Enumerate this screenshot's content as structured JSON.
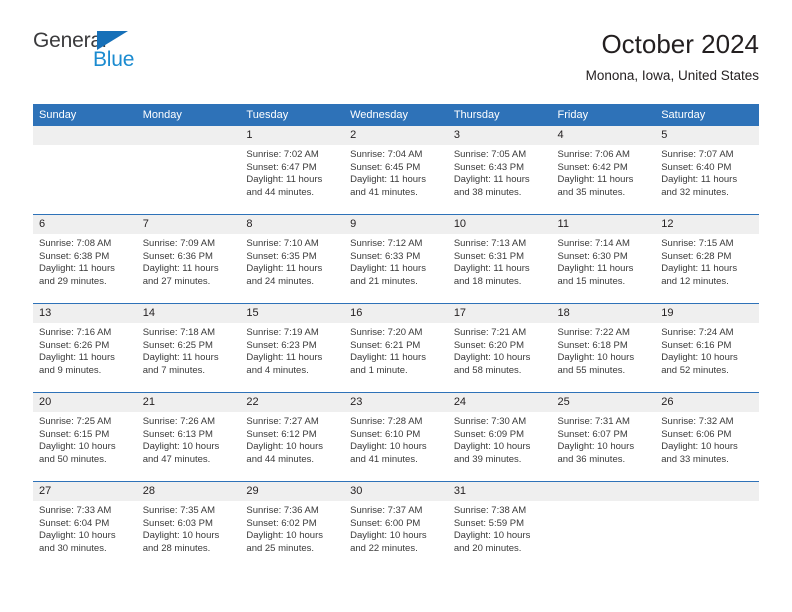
{
  "brand": {
    "name_part1": "General",
    "name_part2": "Blue",
    "triangle_icon": "triangle-icon",
    "accent_color": "#1b8bd0",
    "dark_color": "#3b3b3d"
  },
  "header": {
    "title": "October 2024",
    "subtitle": "Monona, Iowa, United States"
  },
  "theme": {
    "header_blue": "#2e72b8",
    "daynum_bg": "#efefef",
    "text": "#231f20"
  },
  "calendar": {
    "weekday_headers": [
      "Sunday",
      "Monday",
      "Tuesday",
      "Wednesday",
      "Thursday",
      "Friday",
      "Saturday"
    ],
    "weeks": [
      [
        {
          "day": "",
          "sunrise": "",
          "sunset": "",
          "daylight_line1": "",
          "daylight_line2": ""
        },
        {
          "day": "",
          "sunrise": "",
          "sunset": "",
          "daylight_line1": "",
          "daylight_line2": ""
        },
        {
          "day": "1",
          "sunrise": "Sunrise: 7:02 AM",
          "sunset": "Sunset: 6:47 PM",
          "daylight_line1": "Daylight: 11 hours",
          "daylight_line2": "and 44 minutes."
        },
        {
          "day": "2",
          "sunrise": "Sunrise: 7:04 AM",
          "sunset": "Sunset: 6:45 PM",
          "daylight_line1": "Daylight: 11 hours",
          "daylight_line2": "and 41 minutes."
        },
        {
          "day": "3",
          "sunrise": "Sunrise: 7:05 AM",
          "sunset": "Sunset: 6:43 PM",
          "daylight_line1": "Daylight: 11 hours",
          "daylight_line2": "and 38 minutes."
        },
        {
          "day": "4",
          "sunrise": "Sunrise: 7:06 AM",
          "sunset": "Sunset: 6:42 PM",
          "daylight_line1": "Daylight: 11 hours",
          "daylight_line2": "and 35 minutes."
        },
        {
          "day": "5",
          "sunrise": "Sunrise: 7:07 AM",
          "sunset": "Sunset: 6:40 PM",
          "daylight_line1": "Daylight: 11 hours",
          "daylight_line2": "and 32 minutes."
        }
      ],
      [
        {
          "day": "6",
          "sunrise": "Sunrise: 7:08 AM",
          "sunset": "Sunset: 6:38 PM",
          "daylight_line1": "Daylight: 11 hours",
          "daylight_line2": "and 29 minutes."
        },
        {
          "day": "7",
          "sunrise": "Sunrise: 7:09 AM",
          "sunset": "Sunset: 6:36 PM",
          "daylight_line1": "Daylight: 11 hours",
          "daylight_line2": "and 27 minutes."
        },
        {
          "day": "8",
          "sunrise": "Sunrise: 7:10 AM",
          "sunset": "Sunset: 6:35 PM",
          "daylight_line1": "Daylight: 11 hours",
          "daylight_line2": "and 24 minutes."
        },
        {
          "day": "9",
          "sunrise": "Sunrise: 7:12 AM",
          "sunset": "Sunset: 6:33 PM",
          "daylight_line1": "Daylight: 11 hours",
          "daylight_line2": "and 21 minutes."
        },
        {
          "day": "10",
          "sunrise": "Sunrise: 7:13 AM",
          "sunset": "Sunset: 6:31 PM",
          "daylight_line1": "Daylight: 11 hours",
          "daylight_line2": "and 18 minutes."
        },
        {
          "day": "11",
          "sunrise": "Sunrise: 7:14 AM",
          "sunset": "Sunset: 6:30 PM",
          "daylight_line1": "Daylight: 11 hours",
          "daylight_line2": "and 15 minutes."
        },
        {
          "day": "12",
          "sunrise": "Sunrise: 7:15 AM",
          "sunset": "Sunset: 6:28 PM",
          "daylight_line1": "Daylight: 11 hours",
          "daylight_line2": "and 12 minutes."
        }
      ],
      [
        {
          "day": "13",
          "sunrise": "Sunrise: 7:16 AM",
          "sunset": "Sunset: 6:26 PM",
          "daylight_line1": "Daylight: 11 hours",
          "daylight_line2": "and 9 minutes."
        },
        {
          "day": "14",
          "sunrise": "Sunrise: 7:18 AM",
          "sunset": "Sunset: 6:25 PM",
          "daylight_line1": "Daylight: 11 hours",
          "daylight_line2": "and 7 minutes."
        },
        {
          "day": "15",
          "sunrise": "Sunrise: 7:19 AM",
          "sunset": "Sunset: 6:23 PM",
          "daylight_line1": "Daylight: 11 hours",
          "daylight_line2": "and 4 minutes."
        },
        {
          "day": "16",
          "sunrise": "Sunrise: 7:20 AM",
          "sunset": "Sunset: 6:21 PM",
          "daylight_line1": "Daylight: 11 hours",
          "daylight_line2": "and 1 minute."
        },
        {
          "day": "17",
          "sunrise": "Sunrise: 7:21 AM",
          "sunset": "Sunset: 6:20 PM",
          "daylight_line1": "Daylight: 10 hours",
          "daylight_line2": "and 58 minutes."
        },
        {
          "day": "18",
          "sunrise": "Sunrise: 7:22 AM",
          "sunset": "Sunset: 6:18 PM",
          "daylight_line1": "Daylight: 10 hours",
          "daylight_line2": "and 55 minutes."
        },
        {
          "day": "19",
          "sunrise": "Sunrise: 7:24 AM",
          "sunset": "Sunset: 6:16 PM",
          "daylight_line1": "Daylight: 10 hours",
          "daylight_line2": "and 52 minutes."
        }
      ],
      [
        {
          "day": "20",
          "sunrise": "Sunrise: 7:25 AM",
          "sunset": "Sunset: 6:15 PM",
          "daylight_line1": "Daylight: 10 hours",
          "daylight_line2": "and 50 minutes."
        },
        {
          "day": "21",
          "sunrise": "Sunrise: 7:26 AM",
          "sunset": "Sunset: 6:13 PM",
          "daylight_line1": "Daylight: 10 hours",
          "daylight_line2": "and 47 minutes."
        },
        {
          "day": "22",
          "sunrise": "Sunrise: 7:27 AM",
          "sunset": "Sunset: 6:12 PM",
          "daylight_line1": "Daylight: 10 hours",
          "daylight_line2": "and 44 minutes."
        },
        {
          "day": "23",
          "sunrise": "Sunrise: 7:28 AM",
          "sunset": "Sunset: 6:10 PM",
          "daylight_line1": "Daylight: 10 hours",
          "daylight_line2": "and 41 minutes."
        },
        {
          "day": "24",
          "sunrise": "Sunrise: 7:30 AM",
          "sunset": "Sunset: 6:09 PM",
          "daylight_line1": "Daylight: 10 hours",
          "daylight_line2": "and 39 minutes."
        },
        {
          "day": "25",
          "sunrise": "Sunrise: 7:31 AM",
          "sunset": "Sunset: 6:07 PM",
          "daylight_line1": "Daylight: 10 hours",
          "daylight_line2": "and 36 minutes."
        },
        {
          "day": "26",
          "sunrise": "Sunrise: 7:32 AM",
          "sunset": "Sunset: 6:06 PM",
          "daylight_line1": "Daylight: 10 hours",
          "daylight_line2": "and 33 minutes."
        }
      ],
      [
        {
          "day": "27",
          "sunrise": "Sunrise: 7:33 AM",
          "sunset": "Sunset: 6:04 PM",
          "daylight_line1": "Daylight: 10 hours",
          "daylight_line2": "and 30 minutes."
        },
        {
          "day": "28",
          "sunrise": "Sunrise: 7:35 AM",
          "sunset": "Sunset: 6:03 PM",
          "daylight_line1": "Daylight: 10 hours",
          "daylight_line2": "and 28 minutes."
        },
        {
          "day": "29",
          "sunrise": "Sunrise: 7:36 AM",
          "sunset": "Sunset: 6:02 PM",
          "daylight_line1": "Daylight: 10 hours",
          "daylight_line2": "and 25 minutes."
        },
        {
          "day": "30",
          "sunrise": "Sunrise: 7:37 AM",
          "sunset": "Sunset: 6:00 PM",
          "daylight_line1": "Daylight: 10 hours",
          "daylight_line2": "and 22 minutes."
        },
        {
          "day": "31",
          "sunrise": "Sunrise: 7:38 AM",
          "sunset": "Sunset: 5:59 PM",
          "daylight_line1": "Daylight: 10 hours",
          "daylight_line2": "and 20 minutes."
        },
        {
          "day": "",
          "sunrise": "",
          "sunset": "",
          "daylight_line1": "",
          "daylight_line2": ""
        },
        {
          "day": "",
          "sunrise": "",
          "sunset": "",
          "daylight_line1": "",
          "daylight_line2": ""
        }
      ]
    ]
  }
}
